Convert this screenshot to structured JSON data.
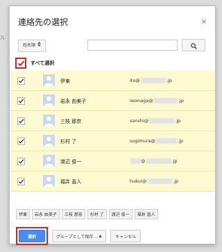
{
  "dialog": {
    "title": "連絡先の選択",
    "close_icon": "×"
  },
  "toolbar": {
    "sort_label": "姓名順",
    "search_placeholder": "",
    "search_icon": "search-icon"
  },
  "select_all": {
    "label": "すべて選択",
    "checked": true
  },
  "contacts": [
    {
      "name": "伊東",
      "email_prefix": "ito@",
      "email_suffix": ".jp"
    },
    {
      "name": "岩永 由美子",
      "email_prefix": "iwanaga@",
      "email_suffix": ".jp"
    },
    {
      "name": "三枝 那奈",
      "email_prefix": "sanshi@",
      "email_suffix": ".jp"
    },
    {
      "name": "杉村 了",
      "email_prefix": "sugimura@",
      "email_suffix": ".jp"
    },
    {
      "name": "渡辺 俊一",
      "email_prefix": "@",
      "email_suffix": ".jp"
    },
    {
      "name": "福井 直人",
      "email_prefix": "hukui@",
      "email_suffix": ".jp"
    }
  ],
  "selected_chips": [
    "伊東",
    "岩永 由美子",
    "三枝 那奈",
    "杉村 了",
    "渡辺 俊一",
    "福井 直人"
  ],
  "footer": {
    "select_label": "選択",
    "group_label": "グループとして保存...",
    "cancel_label": "キャンセル"
  },
  "colors": {
    "row_bg": "#fdf9d0",
    "highlight": "#c62828",
    "primary": "#4a8af4"
  }
}
